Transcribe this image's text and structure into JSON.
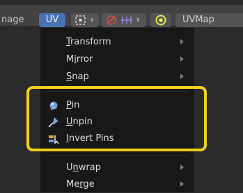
{
  "header": {
    "editor_label": "nage",
    "uv_tab": "UV",
    "uvmap": "UVMap",
    "icons": [
      "select-mode-icon",
      "chevron-down-icon",
      "sync-icon",
      "island-select-icon",
      "proportional-edit-icon"
    ]
  },
  "menu": {
    "items": [
      {
        "pre": "",
        "ul": "T",
        "post": "ransform",
        "submenu": true
      },
      {
        "pre": "M",
        "ul": "i",
        "post": "rror",
        "submenu": true
      },
      {
        "pre": "",
        "ul": "S",
        "post": "nap",
        "submenu": true
      },
      {
        "pre": "",
        "ul": "P",
        "post": "in",
        "submenu": false,
        "icon": "pin-icon"
      },
      {
        "pre": "",
        "ul": "U",
        "post": "npin",
        "submenu": false,
        "icon": "unpin-icon"
      },
      {
        "pre": "",
        "ul": "I",
        "post": "nvert Pins",
        "submenu": false,
        "icon": "invert-pins-icon"
      },
      {
        "pre": "U",
        "ul": "n",
        "post": "wrap",
        "submenu": true
      },
      {
        "pre": "Me",
        "ul": "r",
        "post": "ge",
        "submenu": true
      }
    ]
  },
  "colors": {
    "accent": "#4772b3",
    "highlight": "#f2cf1a",
    "menu_bg": "#181818",
    "header_bg": "#424242"
  }
}
